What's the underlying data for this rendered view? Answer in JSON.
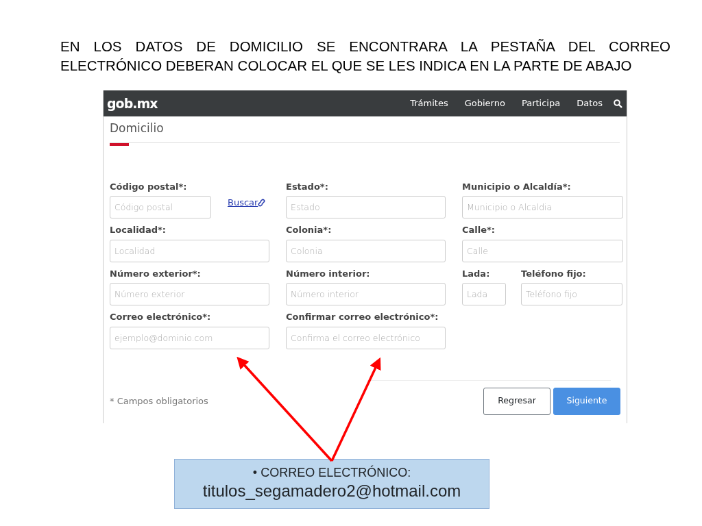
{
  "slide": {
    "heading": "EN LOS DATOS DE DOMICILIO SE ENCONTRARA LA PESTAÑA DEL CORREO ELECTRÓNICO DEBERAN COLOCAR EL QUE SE LES INDICA EN LA PARTE DE ABAJO"
  },
  "navbar": {
    "logo": "gob.mx",
    "items": [
      "Trámites",
      "Gobierno",
      "Participa",
      "Datos"
    ]
  },
  "section_title": "Domicilio",
  "rows": [
    [
      {
        "label": "Código postal*:",
        "placeholder": "Código postal",
        "link": "Buscar"
      },
      {
        "label": "Estado*:",
        "placeholder": "Estado"
      },
      {
        "label": "Municipio o Alcaldía*:",
        "placeholder": "Municipio o Alcaldia"
      }
    ],
    [
      {
        "label": "Localidad*:",
        "placeholder": "Localidad"
      },
      {
        "label": "Colonia*:",
        "placeholder": "Colonia"
      },
      {
        "label": "Calle*:",
        "placeholder": "Calle"
      }
    ],
    [
      {
        "label": "Número exterior*:",
        "placeholder": "Número exterior"
      },
      {
        "label": "Número interior:",
        "placeholder": "Número interior"
      },
      {
        "label": "Lada:",
        "placeholder": "Lada",
        "kind": "short"
      },
      {
        "label": "Teléfono fijo:",
        "placeholder": "Teléfono fijo",
        "kind": "short2"
      }
    ],
    [
      {
        "label": "Correo electrónico*:",
        "placeholder": "ejemplo@dominio.com"
      },
      {
        "label": "Confirmar correo electrónico*:",
        "placeholder": "Confirma el correo electrónico"
      }
    ]
  ],
  "footnote": "* Campos obligatorios",
  "buttons": [
    {
      "label": "Regresar",
      "kind": "secondary"
    },
    {
      "label": "Siguiente",
      "kind": "primary"
    }
  ],
  "callout": {
    "bullet": "•",
    "label": "CORREO ELECTRÓNICO:",
    "email": "titulos_segamadero2@hotmail.com"
  }
}
